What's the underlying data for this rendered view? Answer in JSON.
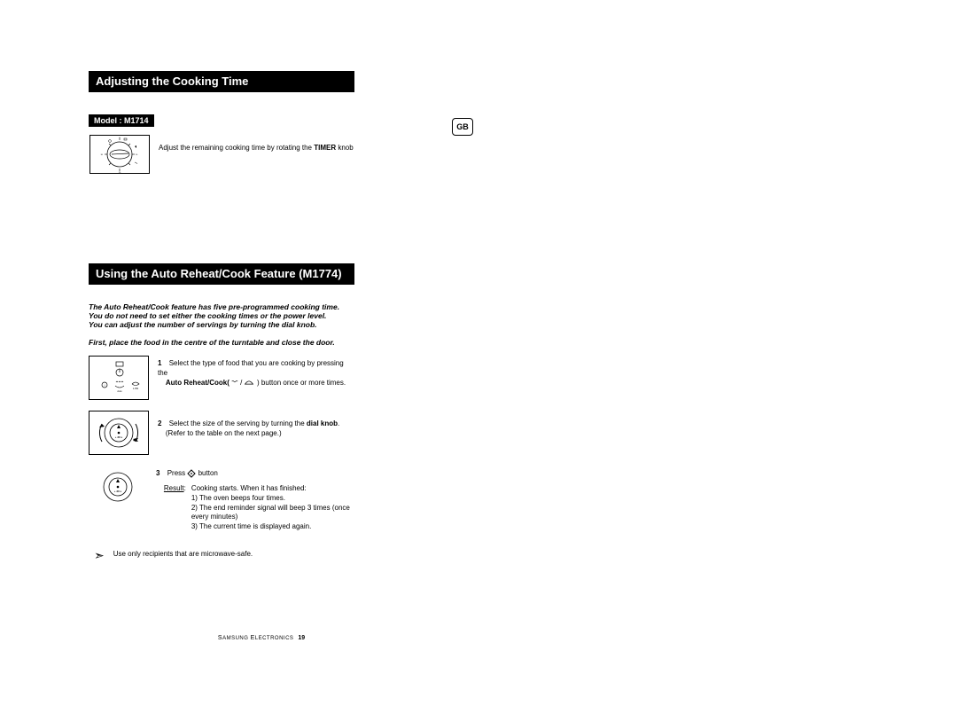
{
  "header1": "Adjusting the Cooking Time",
  "model_label": "Model : M1714",
  "adjust_text_a": "Adjust the remaining cooking time by rotating the ",
  "adjust_text_b": "TIMER",
  "adjust_text_c": " knob",
  "header2": "Using the Auto Reheat/Cook Feature (M1774)",
  "intro_line1": "The Auto Reheat/Cook feature has five pre-programmed cooking time.",
  "intro_line2": "You do not need to set either the cooking times or the power level.",
  "intro_line3": "You can adjust the number of servings by turning the dial knob.",
  "intro2": "First, place the food in the centre of the turntable and close the door.",
  "steps": [
    {
      "num": "1",
      "pre": "Select the type of food that you are cooking by pressing the",
      "bold": "Auto Reheat/Cook(",
      "post": ")  button once or more times."
    },
    {
      "num": "2",
      "pre": "Select the size of the serving by turning the ",
      "bold": "dial knob",
      "post2": "(Refer to the table on the next page.)"
    },
    {
      "num": "3",
      "pre": "Press ",
      "post": " button",
      "result_label": "Result",
      "result_intro": "Cooking starts. When it has finished:",
      "result_1": "1) The oven beeps four times.",
      "result_2": "2) The end reminder signal will beep 3 times (once every minutes)",
      "result_3": "3) The current time is displayed again."
    }
  ],
  "tip": "Use only recipients that are microwave-safe.",
  "gb": "GB",
  "footer_brand_a": "S",
  "footer_brand_b": "AMSUNG ",
  "footer_brand_c": "E",
  "footer_brand_d": "LECTRONICS",
  "footer_page": "19",
  "icons": {
    "timer": "timer-dial",
    "knob": "dial-knob",
    "button": "control-panel"
  }
}
